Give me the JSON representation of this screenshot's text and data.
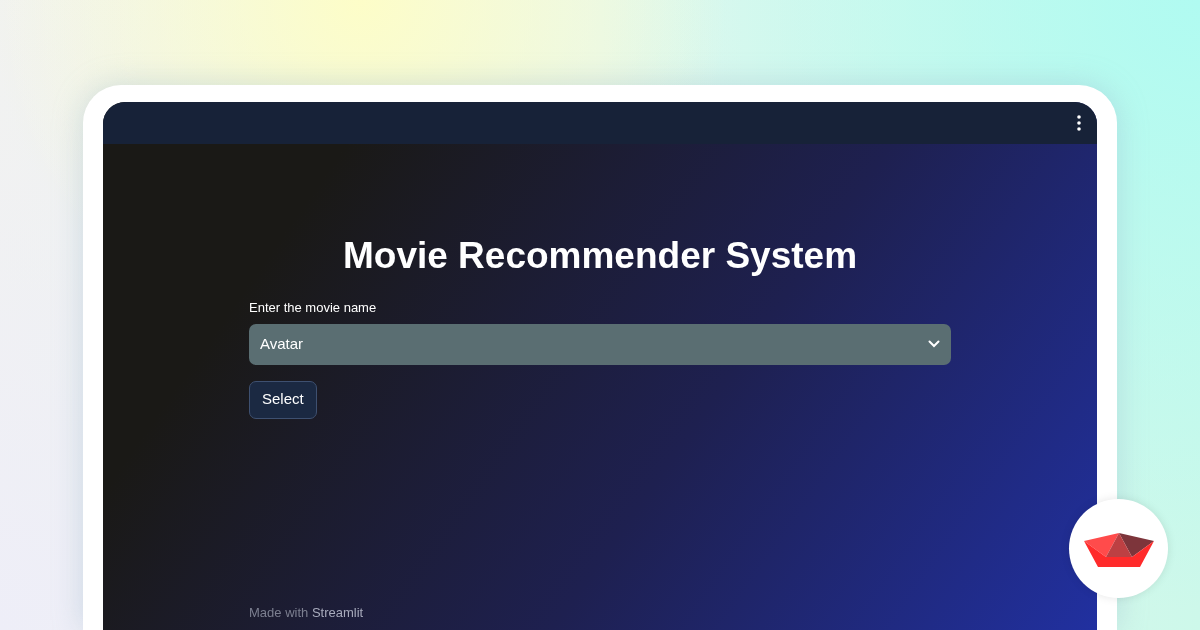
{
  "app": {
    "title": "Movie Recommender System",
    "select": {
      "label": "Enter the movie name",
      "value": "Avatar"
    },
    "button": "Select",
    "footer": {
      "text": "Made with",
      "link": "Streamlit"
    }
  }
}
